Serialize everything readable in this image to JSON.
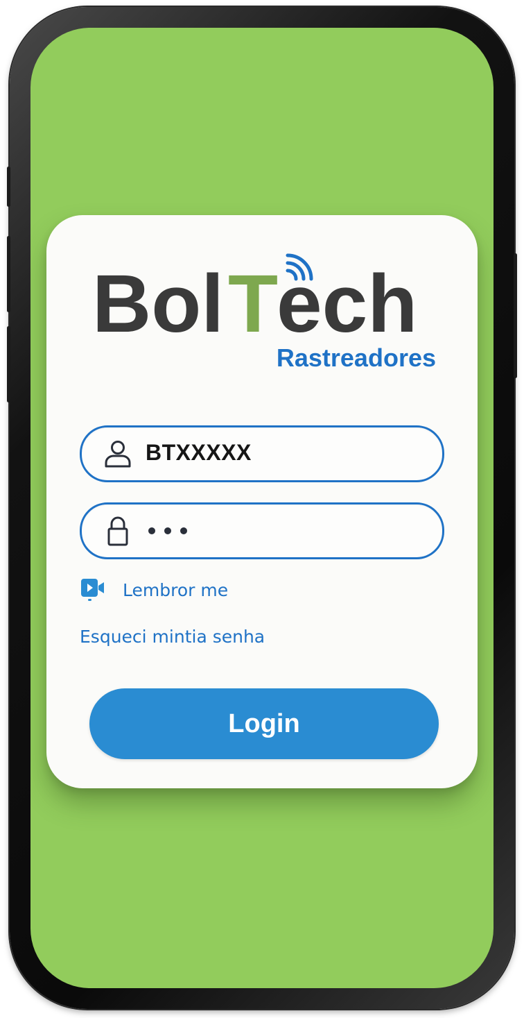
{
  "logo": {
    "brand_dark": "Bol",
    "brand_t": "T",
    "brand_rest": "ech",
    "tagline": "Rastreadores"
  },
  "login_form": {
    "username": {
      "value": "BTXXXXX",
      "icon": "user-icon"
    },
    "password": {
      "masked_length": 3,
      "icon": "lock-icon"
    },
    "remember_label": "Lembror me",
    "remember_icon": "video-camera-icon",
    "forgot_link": "Esqueci mintia senha",
    "submit_label": "Login"
  },
  "colors": {
    "background_green": "#92cc5c",
    "accent_blue": "#1f72c6",
    "button_blue": "#2a8cd2",
    "logo_dark": "#3a3a3a",
    "logo_green": "#7ea84f",
    "card_white": "#fbfbf9"
  }
}
